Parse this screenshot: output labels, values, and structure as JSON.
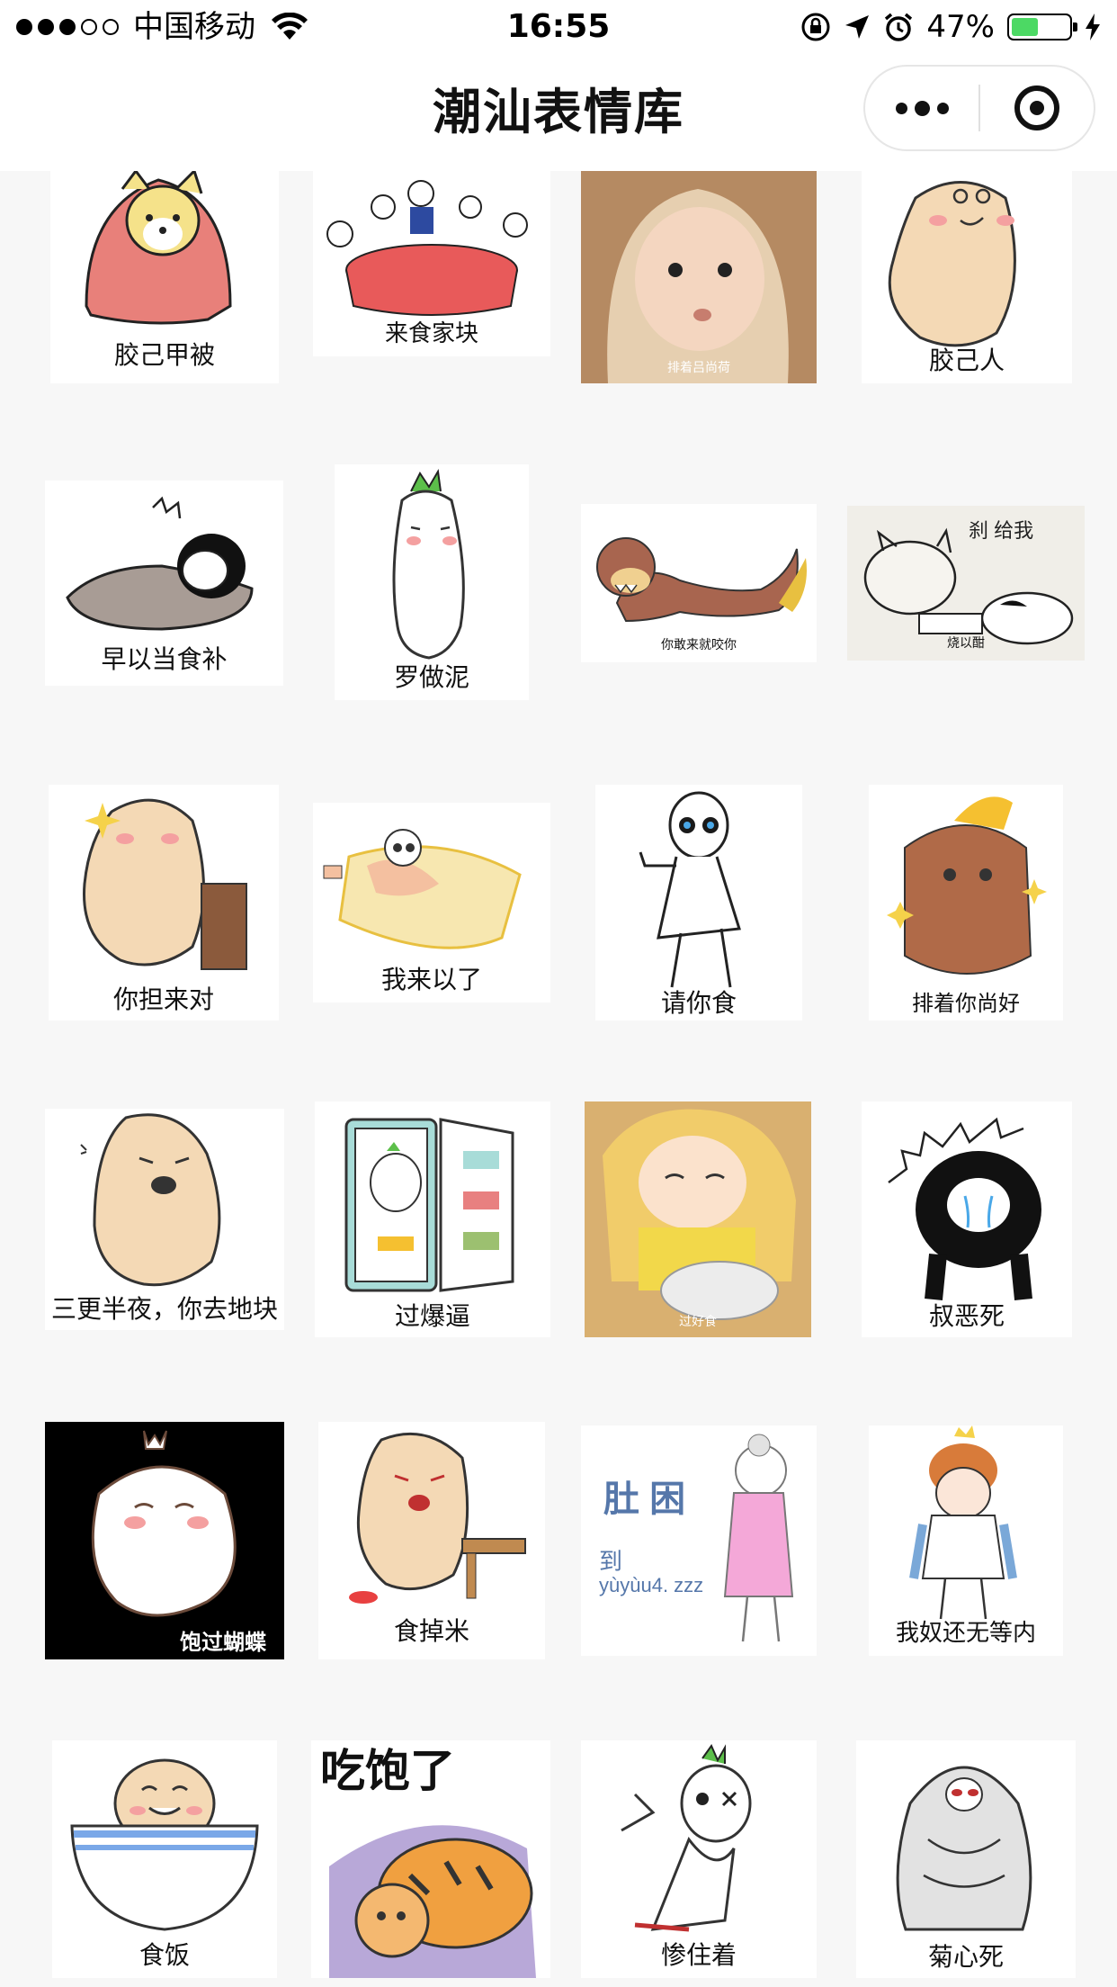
{
  "status_bar": {
    "carrier": "中国移动",
    "time": "16:55",
    "battery_percent": "47%",
    "battery_level": 0.47,
    "signal_bars": 3,
    "signal_total": 5,
    "icons": [
      "wifi-icon",
      "rotation-lock-icon",
      "location-arrow-icon",
      "alarm-icon",
      "battery-icon",
      "charging-icon"
    ]
  },
  "nav": {
    "title": "潮汕表情库",
    "capsule_icons": [
      "more-icon",
      "close-target-icon"
    ]
  },
  "stickers": [
    {
      "caption": "胶己甲被",
      "subject": "shiba-in-blanket"
    },
    {
      "caption": "来食家块",
      "subject": "banquet-table"
    },
    {
      "caption": "排着吕尚荷",
      "subject": "baby-photo"
    },
    {
      "caption": "胶己人",
      "subject": "potato-smirk"
    },
    {
      "caption": "早以当食补",
      "subject": "sleeping-under-blanket"
    },
    {
      "caption": "罗做泥",
      "subject": "radish-shy"
    },
    {
      "caption": "你敢来就咬你",
      "subject": "otter-creature"
    },
    {
      "caption": "烧以酣",
      "subject": "sketch-cats"
    },
    {
      "caption": "你担来对",
      "subject": "potato-pointing"
    },
    {
      "caption": "我来以了",
      "subject": "lying-on-pillow"
    },
    {
      "caption": "请你食",
      "subject": "stick-figure"
    },
    {
      "caption": "排着你尚好",
      "subject": "brown-bear-sparkle"
    },
    {
      "caption": "三更半夜，你去地块",
      "subject": "potato-shouting"
    },
    {
      "caption": "过爆逼",
      "subject": "radish-in-fridge"
    },
    {
      "caption": "过好食",
      "subject": "anime-girl-rice"
    },
    {
      "caption": "叔恶死",
      "subject": "crying-black-hair"
    },
    {
      "caption": "饱过蝴蝶",
      "subject": "ghost-full-belly"
    },
    {
      "caption": "食掉米",
      "subject": "potato-angry-table"
    },
    {
      "caption": "肚困 到 yùyùu4. zzz",
      "subject": "sleepy-granny"
    },
    {
      "caption": "我奴还无等内",
      "subject": "crowned-guy"
    },
    {
      "caption": "食饭",
      "subject": "potato-in-bowl"
    },
    {
      "caption": "吃饱了",
      "subject": "tiger-on-bed"
    },
    {
      "caption": "惨住着",
      "subject": "radish-injured"
    },
    {
      "caption": "菊心死",
      "subject": "wrapped-ghost"
    }
  ]
}
